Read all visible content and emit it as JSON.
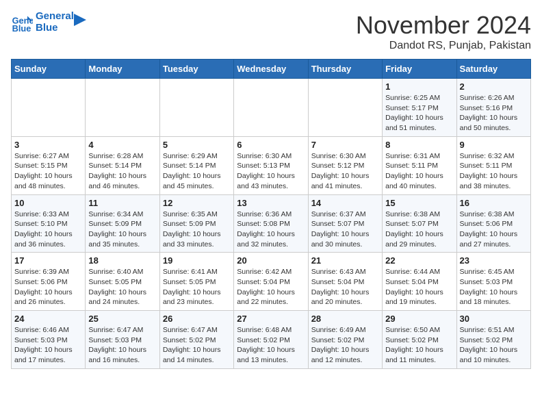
{
  "header": {
    "logo_line1": "General",
    "logo_line2": "Blue",
    "title": "November 2024",
    "subtitle": "Dandot RS, Punjab, Pakistan"
  },
  "weekdays": [
    "Sunday",
    "Monday",
    "Tuesday",
    "Wednesday",
    "Thursday",
    "Friday",
    "Saturday"
  ],
  "weeks": [
    [
      {
        "day": "",
        "info": ""
      },
      {
        "day": "",
        "info": ""
      },
      {
        "day": "",
        "info": ""
      },
      {
        "day": "",
        "info": ""
      },
      {
        "day": "",
        "info": ""
      },
      {
        "day": "1",
        "info": "Sunrise: 6:25 AM\nSunset: 5:17 PM\nDaylight: 10 hours\nand 51 minutes."
      },
      {
        "day": "2",
        "info": "Sunrise: 6:26 AM\nSunset: 5:16 PM\nDaylight: 10 hours\nand 50 minutes."
      }
    ],
    [
      {
        "day": "3",
        "info": "Sunrise: 6:27 AM\nSunset: 5:15 PM\nDaylight: 10 hours\nand 48 minutes."
      },
      {
        "day": "4",
        "info": "Sunrise: 6:28 AM\nSunset: 5:14 PM\nDaylight: 10 hours\nand 46 minutes."
      },
      {
        "day": "5",
        "info": "Sunrise: 6:29 AM\nSunset: 5:14 PM\nDaylight: 10 hours\nand 45 minutes."
      },
      {
        "day": "6",
        "info": "Sunrise: 6:30 AM\nSunset: 5:13 PM\nDaylight: 10 hours\nand 43 minutes."
      },
      {
        "day": "7",
        "info": "Sunrise: 6:30 AM\nSunset: 5:12 PM\nDaylight: 10 hours\nand 41 minutes."
      },
      {
        "day": "8",
        "info": "Sunrise: 6:31 AM\nSunset: 5:11 PM\nDaylight: 10 hours\nand 40 minutes."
      },
      {
        "day": "9",
        "info": "Sunrise: 6:32 AM\nSunset: 5:11 PM\nDaylight: 10 hours\nand 38 minutes."
      }
    ],
    [
      {
        "day": "10",
        "info": "Sunrise: 6:33 AM\nSunset: 5:10 PM\nDaylight: 10 hours\nand 36 minutes."
      },
      {
        "day": "11",
        "info": "Sunrise: 6:34 AM\nSunset: 5:09 PM\nDaylight: 10 hours\nand 35 minutes."
      },
      {
        "day": "12",
        "info": "Sunrise: 6:35 AM\nSunset: 5:09 PM\nDaylight: 10 hours\nand 33 minutes."
      },
      {
        "day": "13",
        "info": "Sunrise: 6:36 AM\nSunset: 5:08 PM\nDaylight: 10 hours\nand 32 minutes."
      },
      {
        "day": "14",
        "info": "Sunrise: 6:37 AM\nSunset: 5:07 PM\nDaylight: 10 hours\nand 30 minutes."
      },
      {
        "day": "15",
        "info": "Sunrise: 6:38 AM\nSunset: 5:07 PM\nDaylight: 10 hours\nand 29 minutes."
      },
      {
        "day": "16",
        "info": "Sunrise: 6:38 AM\nSunset: 5:06 PM\nDaylight: 10 hours\nand 27 minutes."
      }
    ],
    [
      {
        "day": "17",
        "info": "Sunrise: 6:39 AM\nSunset: 5:06 PM\nDaylight: 10 hours\nand 26 minutes."
      },
      {
        "day": "18",
        "info": "Sunrise: 6:40 AM\nSunset: 5:05 PM\nDaylight: 10 hours\nand 24 minutes."
      },
      {
        "day": "19",
        "info": "Sunrise: 6:41 AM\nSunset: 5:05 PM\nDaylight: 10 hours\nand 23 minutes."
      },
      {
        "day": "20",
        "info": "Sunrise: 6:42 AM\nSunset: 5:04 PM\nDaylight: 10 hours\nand 22 minutes."
      },
      {
        "day": "21",
        "info": "Sunrise: 6:43 AM\nSunset: 5:04 PM\nDaylight: 10 hours\nand 20 minutes."
      },
      {
        "day": "22",
        "info": "Sunrise: 6:44 AM\nSunset: 5:04 PM\nDaylight: 10 hours\nand 19 minutes."
      },
      {
        "day": "23",
        "info": "Sunrise: 6:45 AM\nSunset: 5:03 PM\nDaylight: 10 hours\nand 18 minutes."
      }
    ],
    [
      {
        "day": "24",
        "info": "Sunrise: 6:46 AM\nSunset: 5:03 PM\nDaylight: 10 hours\nand 17 minutes."
      },
      {
        "day": "25",
        "info": "Sunrise: 6:47 AM\nSunset: 5:03 PM\nDaylight: 10 hours\nand 16 minutes."
      },
      {
        "day": "26",
        "info": "Sunrise: 6:47 AM\nSunset: 5:02 PM\nDaylight: 10 hours\nand 14 minutes."
      },
      {
        "day": "27",
        "info": "Sunrise: 6:48 AM\nSunset: 5:02 PM\nDaylight: 10 hours\nand 13 minutes."
      },
      {
        "day": "28",
        "info": "Sunrise: 6:49 AM\nSunset: 5:02 PM\nDaylight: 10 hours\nand 12 minutes."
      },
      {
        "day": "29",
        "info": "Sunrise: 6:50 AM\nSunset: 5:02 PM\nDaylight: 10 hours\nand 11 minutes."
      },
      {
        "day": "30",
        "info": "Sunrise: 6:51 AM\nSunset: 5:02 PM\nDaylight: 10 hours\nand 10 minutes."
      }
    ]
  ]
}
